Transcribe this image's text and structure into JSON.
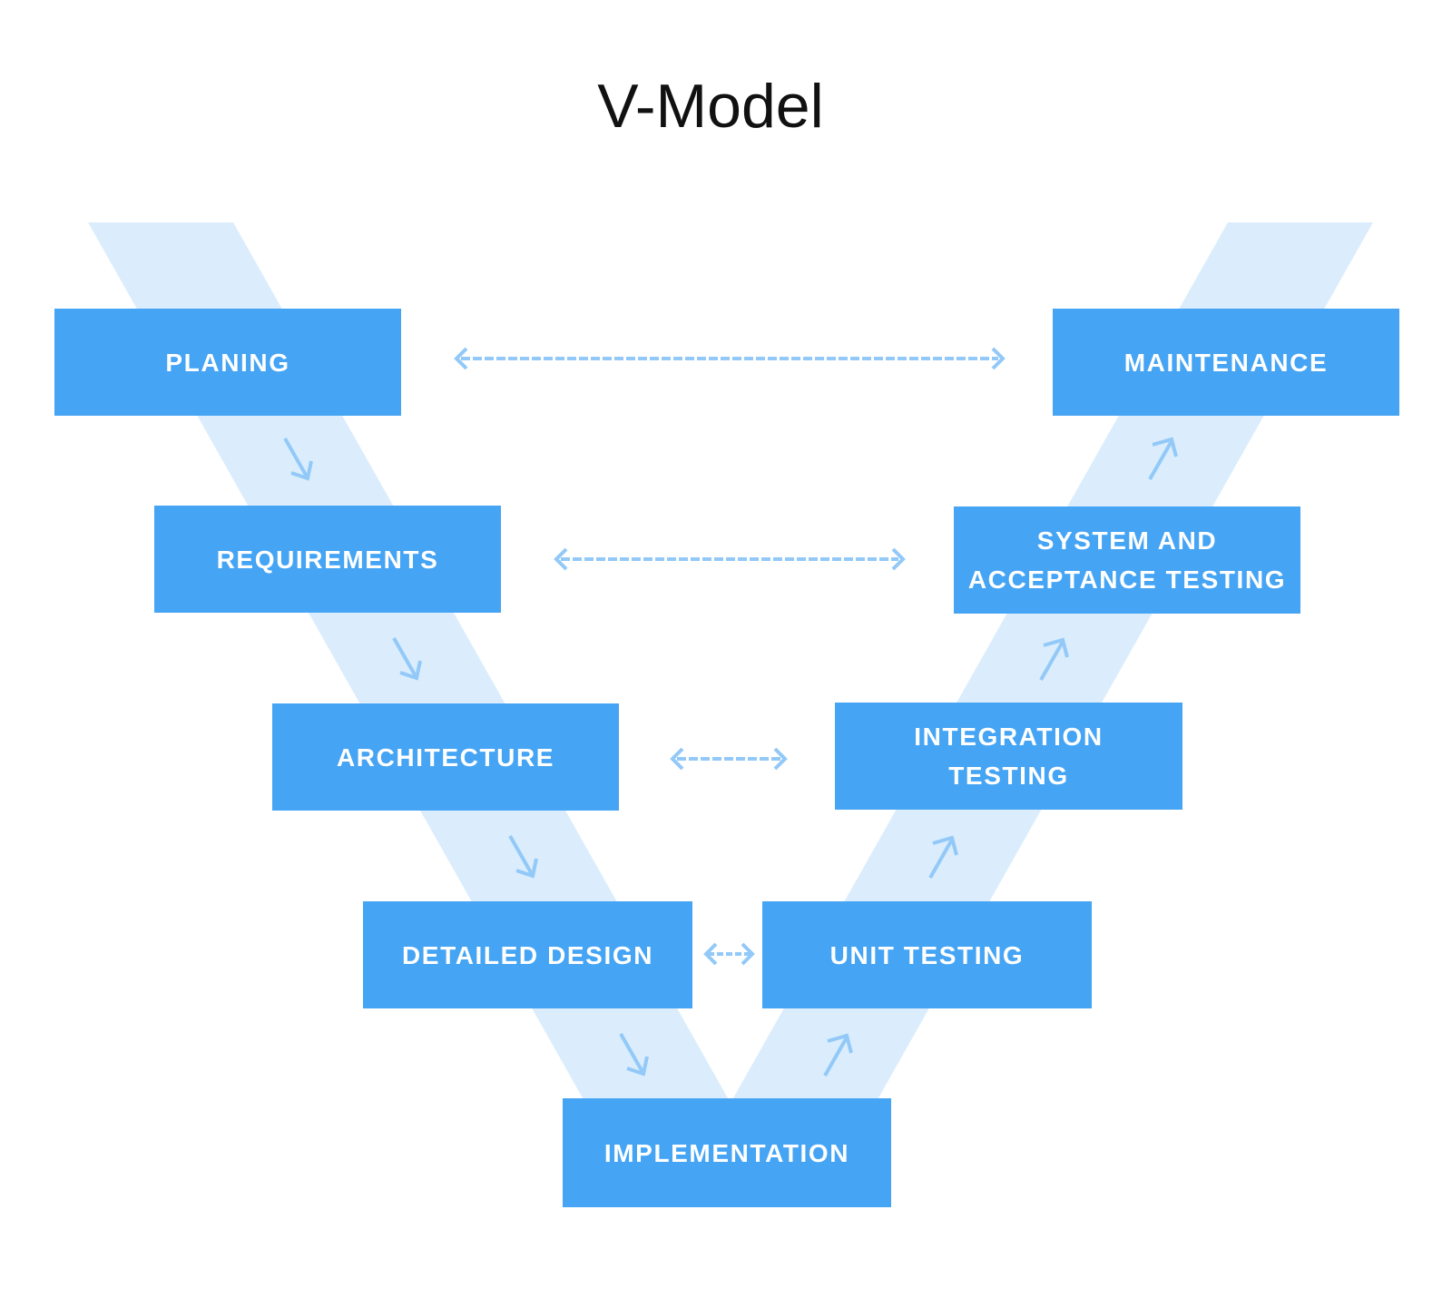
{
  "title": "V-Model",
  "colors": {
    "box": "#45a4f4",
    "band": "#dbedfc",
    "arrow": "#92c9f8",
    "text": "#ffffff"
  },
  "phases": {
    "planning": "PLANING",
    "requirements": "REQUIREMENTS",
    "architecture": "ARCHITECTURE",
    "detailed_design": "DETAILED DESIGN",
    "implementation": "IMPLEMENTATION",
    "unit_testing": "UNIT TESTING",
    "integration_testing": "INTEGRATION TESTING",
    "system_acceptance_testing": "SYSTEM AND ACCEPTANCE TESTING",
    "maintenance": "MAINTENANCE"
  },
  "links": [
    {
      "from": "PLANING",
      "to": "MAINTENANCE",
      "type": "bidirectional-dashed"
    },
    {
      "from": "REQUIREMENTS",
      "to": "SYSTEM AND ACCEPTANCE TESTING",
      "type": "bidirectional-dashed"
    },
    {
      "from": "ARCHITECTURE",
      "to": "INTEGRATION TESTING",
      "type": "bidirectional-dashed"
    },
    {
      "from": "DETAILED DESIGN",
      "to": "UNIT TESTING",
      "type": "bidirectional-dashed"
    }
  ],
  "flow": {
    "left_arm": [
      "PLANING",
      "REQUIREMENTS",
      "ARCHITECTURE",
      "DETAILED DESIGN",
      "IMPLEMENTATION"
    ],
    "right_arm": [
      "IMPLEMENTATION",
      "UNIT TESTING",
      "INTEGRATION TESTING",
      "SYSTEM AND ACCEPTANCE TESTING",
      "MAINTENANCE"
    ]
  }
}
